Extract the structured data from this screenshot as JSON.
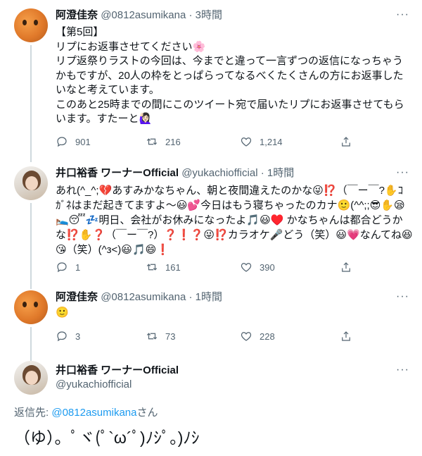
{
  "tweets": [
    {
      "name": "阿澄佳奈",
      "handle": "@0812asumikana",
      "dot": "·",
      "time": "3時間",
      "text": "【第5回】\nリプにお返事させてください🌸\nリプ返祭りラストの今回は、今までと違って一言ずつの返信になっちゃうかもですが、20人の枠をとっぱらってなるべくたくさんの方にお返事したいなと考えています。\nこのあと25時までの間にこのツイート宛で届いたリプにお返事させてもらいます。すたーと🙋🏻‍♀️",
      "replies": "",
      "retweets": "216",
      "likes": "1,214",
      "likes_display": "901"
    },
    {
      "name": "井口裕香 ワーナーOfficial",
      "handle": "@yukachiofficial",
      "dot": "·",
      "time": "1時間",
      "text": "あれ(^_^;💔あすみかなちゃん、朝と夜間違えたのかな😜⁉️（￣ー￣?✋ｺｶﾞﾈはまだ起きてますよ〜😃💕今日はもう寝ちゃったのカナ🙂(^^;;😎✋😪🛌😴💤明日、会社がお休みになったよ🎵😃♥️ かなちゃんは都合どうかな⁉️✋❓（￣ー￣?）❓❗❓😜⁉️カラオケ🎤どう（笑）😃💗なんてね😆😘（笑）(^з<)😃🎵😄❗",
      "replies": "1",
      "retweets": "161",
      "likes": "390"
    },
    {
      "name": "阿澄佳奈",
      "handle": "@0812asumikana",
      "dot": "·",
      "time": "1時間",
      "text": "🙂",
      "replies": "3",
      "retweets": "73",
      "likes": "228"
    }
  ],
  "main": {
    "name": "井口裕香 ワーナーOfficial",
    "handle": "@yukachiofficial",
    "reply_prefix": "返信先: ",
    "reply_mention": "@0812asumikana",
    "reply_suffix": "さん",
    "text": "（ゆ）。ﾟヾ(ﾟ`ω´ﾟ)ﾉｼﾟ。)ﾉｼ"
  },
  "more_icon_label": "···"
}
